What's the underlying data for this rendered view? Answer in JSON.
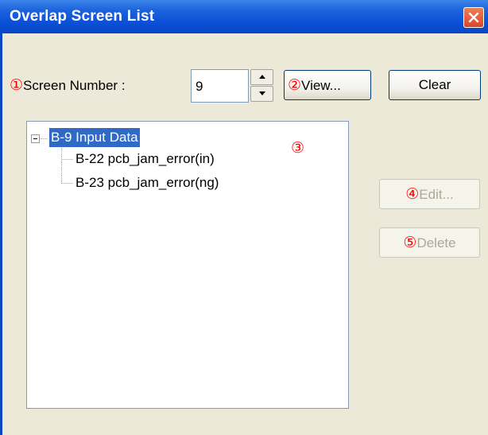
{
  "window": {
    "title": "Overlap Screen List"
  },
  "screen_number": {
    "marker": "①",
    "label": "Screen Number :",
    "value": "9"
  },
  "buttons": {
    "view": {
      "marker": "②",
      "label": "View..."
    },
    "clear": {
      "label": "Clear"
    },
    "edit": {
      "marker": "④",
      "label": "Edit...",
      "enabled": false
    },
    "delete": {
      "marker": "⑤",
      "label": "Delete",
      "enabled": false
    }
  },
  "tree": {
    "marker": "③",
    "root": {
      "label": "B-9 Input Data",
      "expanded": true,
      "selected": true
    },
    "children": [
      {
        "label": "B-22 pcb_jam_error(in)"
      },
      {
        "label": "B-23 pcb_jam_error(ng)"
      }
    ]
  },
  "colors": {
    "title_bar": "#0a4fd6",
    "dialog_background": "#ece9d8",
    "selection": "#316ac5",
    "annotation_marker": "#ff0000",
    "close_button": "#d9452b"
  },
  "icons": [
    "close-icon",
    "spin-up-icon",
    "spin-down-icon",
    "tree-collapse-icon"
  ]
}
